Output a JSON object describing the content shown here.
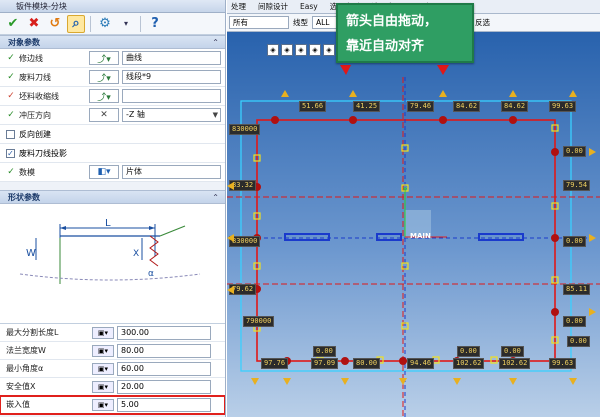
{
  "panel": {
    "title": "钣件模块-分块",
    "section_object": "对象参数",
    "section_shape": "形状参数",
    "rows": [
      {
        "label": "修边线",
        "value": "曲线",
        "checked": true
      },
      {
        "label": "废料刀线",
        "value": "线段*9",
        "checked": true
      },
      {
        "label": "坯料收缩线",
        "value": "",
        "checked": true
      },
      {
        "label": "冲压方向",
        "value": "-Z 轴",
        "checked": true
      }
    ],
    "checkbox_reverse": "反向创建",
    "checkbox_projection": "废料刀线投影",
    "data_label": "数模",
    "data_value": "片体",
    "diagram_labels": {
      "L": "L",
      "W": "W",
      "X": "X",
      "alpha": "α"
    },
    "params": [
      {
        "label": "最大分割长度L",
        "value": "300.00"
      },
      {
        "label": "法兰宽度W",
        "value": "80.00"
      },
      {
        "label": "最小角度α",
        "value": "60.00"
      },
      {
        "label": "安全值X",
        "value": "20.00"
      },
      {
        "label": "嵌入值",
        "value": "5.00"
      }
    ]
  },
  "cad": {
    "menu": [
      "处理",
      "间隙设计",
      "Easy",
      "选项变形",
      "选项产品SP",
      "冲"
    ],
    "toolbar": {
      "combo1": "所有",
      "linetype_label": "线型",
      "combo2": "ALL",
      "select_all": "全选",
      "invert": "反选"
    },
    "callout_line1": "箭头自由拖动，",
    "callout_line2": "靠近自动对齐",
    "center_label": "MAIN",
    "axis_label": "Y",
    "top_labels": [
      "51.66",
      "41.25",
      "79.46",
      "84.62",
      "84.62",
      "99.63"
    ],
    "left_labels": [
      "830000",
      "83.32",
      "830000",
      "79.62",
      "790000"
    ],
    "right_labels": [
      "0.00",
      "79.54",
      "0.00",
      "85.11",
      "0.00"
    ],
    "bottom_labels": [
      "97.76",
      "97.09",
      "80.00",
      "94.46",
      "102.62",
      "102.62",
      "99.63"
    ],
    "bottom_small": [
      "0.00",
      "0.00",
      "0.00",
      "0.00"
    ],
    "accent": "#2f9e63"
  }
}
